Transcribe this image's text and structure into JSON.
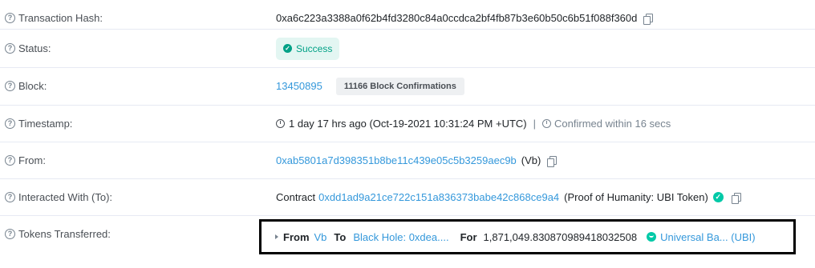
{
  "rows": {
    "tx_hash": {
      "label": "Transaction Hash:",
      "value": "0xa6c223a3388a0f62b4fd3280c84a0ccdca2bf4fb87b3e60b50c6b51f088f360d"
    },
    "status": {
      "label": "Status:",
      "value": "Success"
    },
    "block": {
      "label": "Block:",
      "number": "13450895",
      "confirmations": "11166 Block Confirmations"
    },
    "timestamp": {
      "label": "Timestamp:",
      "value": "1 day 17 hrs ago (Oct-19-2021 10:31:24 PM +UTC)",
      "separator": "|",
      "confirmed": "Confirmed within 16 secs"
    },
    "from": {
      "label": "From:",
      "address": "0xab5801a7d398351b8be11c439e05c5b3259aec9b",
      "tag": "(Vb)"
    },
    "to": {
      "label": "Interacted With (To):",
      "prefix": "Contract",
      "address": "0xdd1ad9a21ce722c151a836373babe42c868ce9a4",
      "tag": "(Proof of Humanity: UBI Token)"
    },
    "tokens": {
      "label": "Tokens Transferred:",
      "from_word": "From",
      "from_value": "Vb",
      "to_word": "To",
      "to_value": "Black Hole: 0xdea....",
      "for_word": "For",
      "amount": "1,871,049.830870989418032508",
      "token_name": "Universal Ba... (UBI)"
    }
  },
  "icons": {
    "help": "question-circle-icon",
    "copy": "copy-icon",
    "check": "check-circle-icon",
    "clock": "clock-icon",
    "timer": "timer-icon",
    "verified": "verified-check-icon",
    "caret": "caret-right-icon",
    "token": "ubi-token-icon"
  },
  "colors": {
    "link": "#3498db",
    "success_bg": "#e3f6f2",
    "success_text": "#00a186",
    "badge_bg": "#eef0f2",
    "verified": "#00c9a7"
  }
}
